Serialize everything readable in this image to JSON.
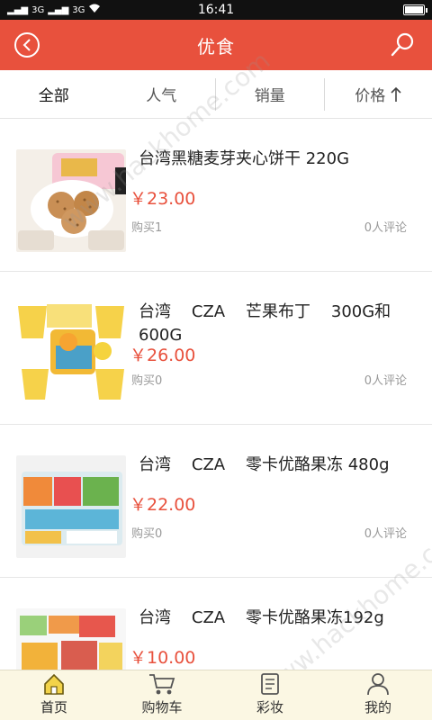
{
  "status_bar": {
    "time": "16:41",
    "signal_left": "3G",
    "signal_right": "3G"
  },
  "header": {
    "title": "优食"
  },
  "tabs": [
    {
      "label": "全部",
      "active": true
    },
    {
      "label": "人气"
    },
    {
      "label": "销量"
    },
    {
      "label": "价格",
      "sort_icon": "arrow-up-icon"
    }
  ],
  "products": [
    {
      "title": "台湾黑糖麦芽夹心饼干 220G",
      "price": "￥23.00",
      "bought": "购买1",
      "comments": "0人评论",
      "image": "cookies"
    },
    {
      "title": "台湾    CZA    芒果布丁    300G和600G",
      "price": "￥26.00",
      "bought": "购买0",
      "comments": "0人评论",
      "image": "mango-pudding"
    },
    {
      "title": "台湾    CZA    零卡优酪果冻 480g",
      "price": "￥22.00",
      "bought": "购买0",
      "comments": "0人评论",
      "image": "jelly-pack"
    },
    {
      "title": "台湾    CZA    零卡优酪果冻192g",
      "price": "￥10.00",
      "bought": "",
      "comments": "",
      "image": "jelly-small"
    }
  ],
  "bottom_nav": [
    {
      "label": "首页",
      "icon": "home-icon",
      "active": true
    },
    {
      "label": "购物车",
      "icon": "cart-icon"
    },
    {
      "label": "彩妆",
      "icon": "makeup-icon"
    },
    {
      "label": "我的",
      "icon": "user-icon"
    }
  ],
  "watermark": "www.hackhome.com",
  "colors": {
    "accent": "#e8513d",
    "bottom_nav_bg": "#fbf7e3"
  }
}
